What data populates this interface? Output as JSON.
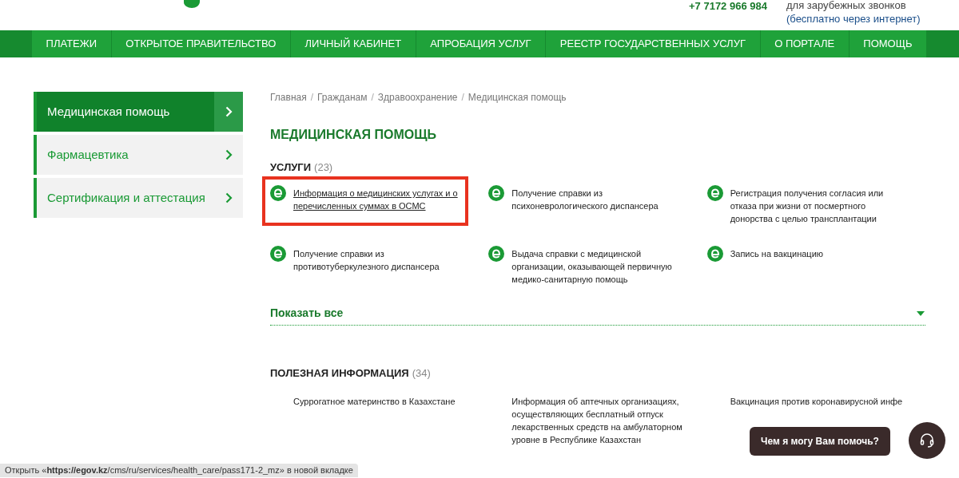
{
  "header": {
    "phone": "+7 7172 966 984",
    "note": "для зарубежных звонков",
    "free_link": "(бесплатно через интернет)"
  },
  "nav": [
    {
      "label": "ПЛАТЕЖИ"
    },
    {
      "label": "ОТКРЫТОЕ ПРАВИТЕЛЬСТВО"
    },
    {
      "label": "ЛИЧНЫЙ КАБИНЕТ"
    },
    {
      "label": "АПРОБАЦИЯ УСЛУГ"
    },
    {
      "label": "РЕЕСТР ГОСУДАРСТВЕННЫХ УСЛУГ"
    },
    {
      "label": "О ПОРТАЛЕ"
    },
    {
      "label": "ПОМОЩЬ"
    }
  ],
  "sidebar": [
    {
      "label": "Медицинская помощь",
      "selected": true
    },
    {
      "label": "Фармацевтика",
      "selected": false
    },
    {
      "label": "Сертификация и аттестация",
      "selected": false
    }
  ],
  "breadcrumbs": [
    {
      "kind": "link",
      "text": "Главная"
    },
    {
      "kind": "separator",
      "text": "/"
    },
    {
      "kind": "link",
      "text": "Гражданам"
    },
    {
      "kind": "separator",
      "text": "/"
    },
    {
      "kind": "link",
      "text": "Здравоохранение"
    },
    {
      "kind": "separator",
      "text": "/"
    },
    {
      "kind": "link",
      "text": "Медицинская помощь"
    }
  ],
  "title": "МЕДИЦИНСКАЯ ПОМОЩЬ",
  "services": {
    "heading": "УСЛУГИ",
    "count": "(23)",
    "items": [
      {
        "label": "Информация о медицинских услугах и о перечисленных суммах в ОСМС",
        "highlighted": true
      },
      {
        "label": "Получение справки из психоневрологического диспансера",
        "highlighted": false
      },
      {
        "label": "Регистрация получения согласия или отказа при жизни от посмертного донорства с целью трансплантации",
        "highlighted": false
      },
      {
        "label": "Получение справки из противотуберкулезного диспансера",
        "highlighted": false
      },
      {
        "label": "Выдача справки с медицинской организации, оказывающей первичную медико-санитарную помощь",
        "highlighted": false
      },
      {
        "label": "Запись на вакцинацию",
        "highlighted": false
      }
    ],
    "show_all": "Показать все"
  },
  "info": {
    "heading": "ПОЛЕЗНАЯ ИНФОРМАЦИЯ",
    "count": "(34)",
    "items": [
      "Суррогатное материнство в Казахстане",
      "Информация об аптечных организациях, осуществляющих бесплатный отпуск лекарственных средств на амбулаторном уровне в Республике Казахстан",
      "Вакцинация против коронавирусной инфе"
    ]
  },
  "chat": {
    "bubble": "Чем я могу Вам помочь?"
  },
  "status_bar": "Открыть «**https://egov.kz**/cms/ru/services/health_care/pass171-2_mz» в новой вкладке"
}
